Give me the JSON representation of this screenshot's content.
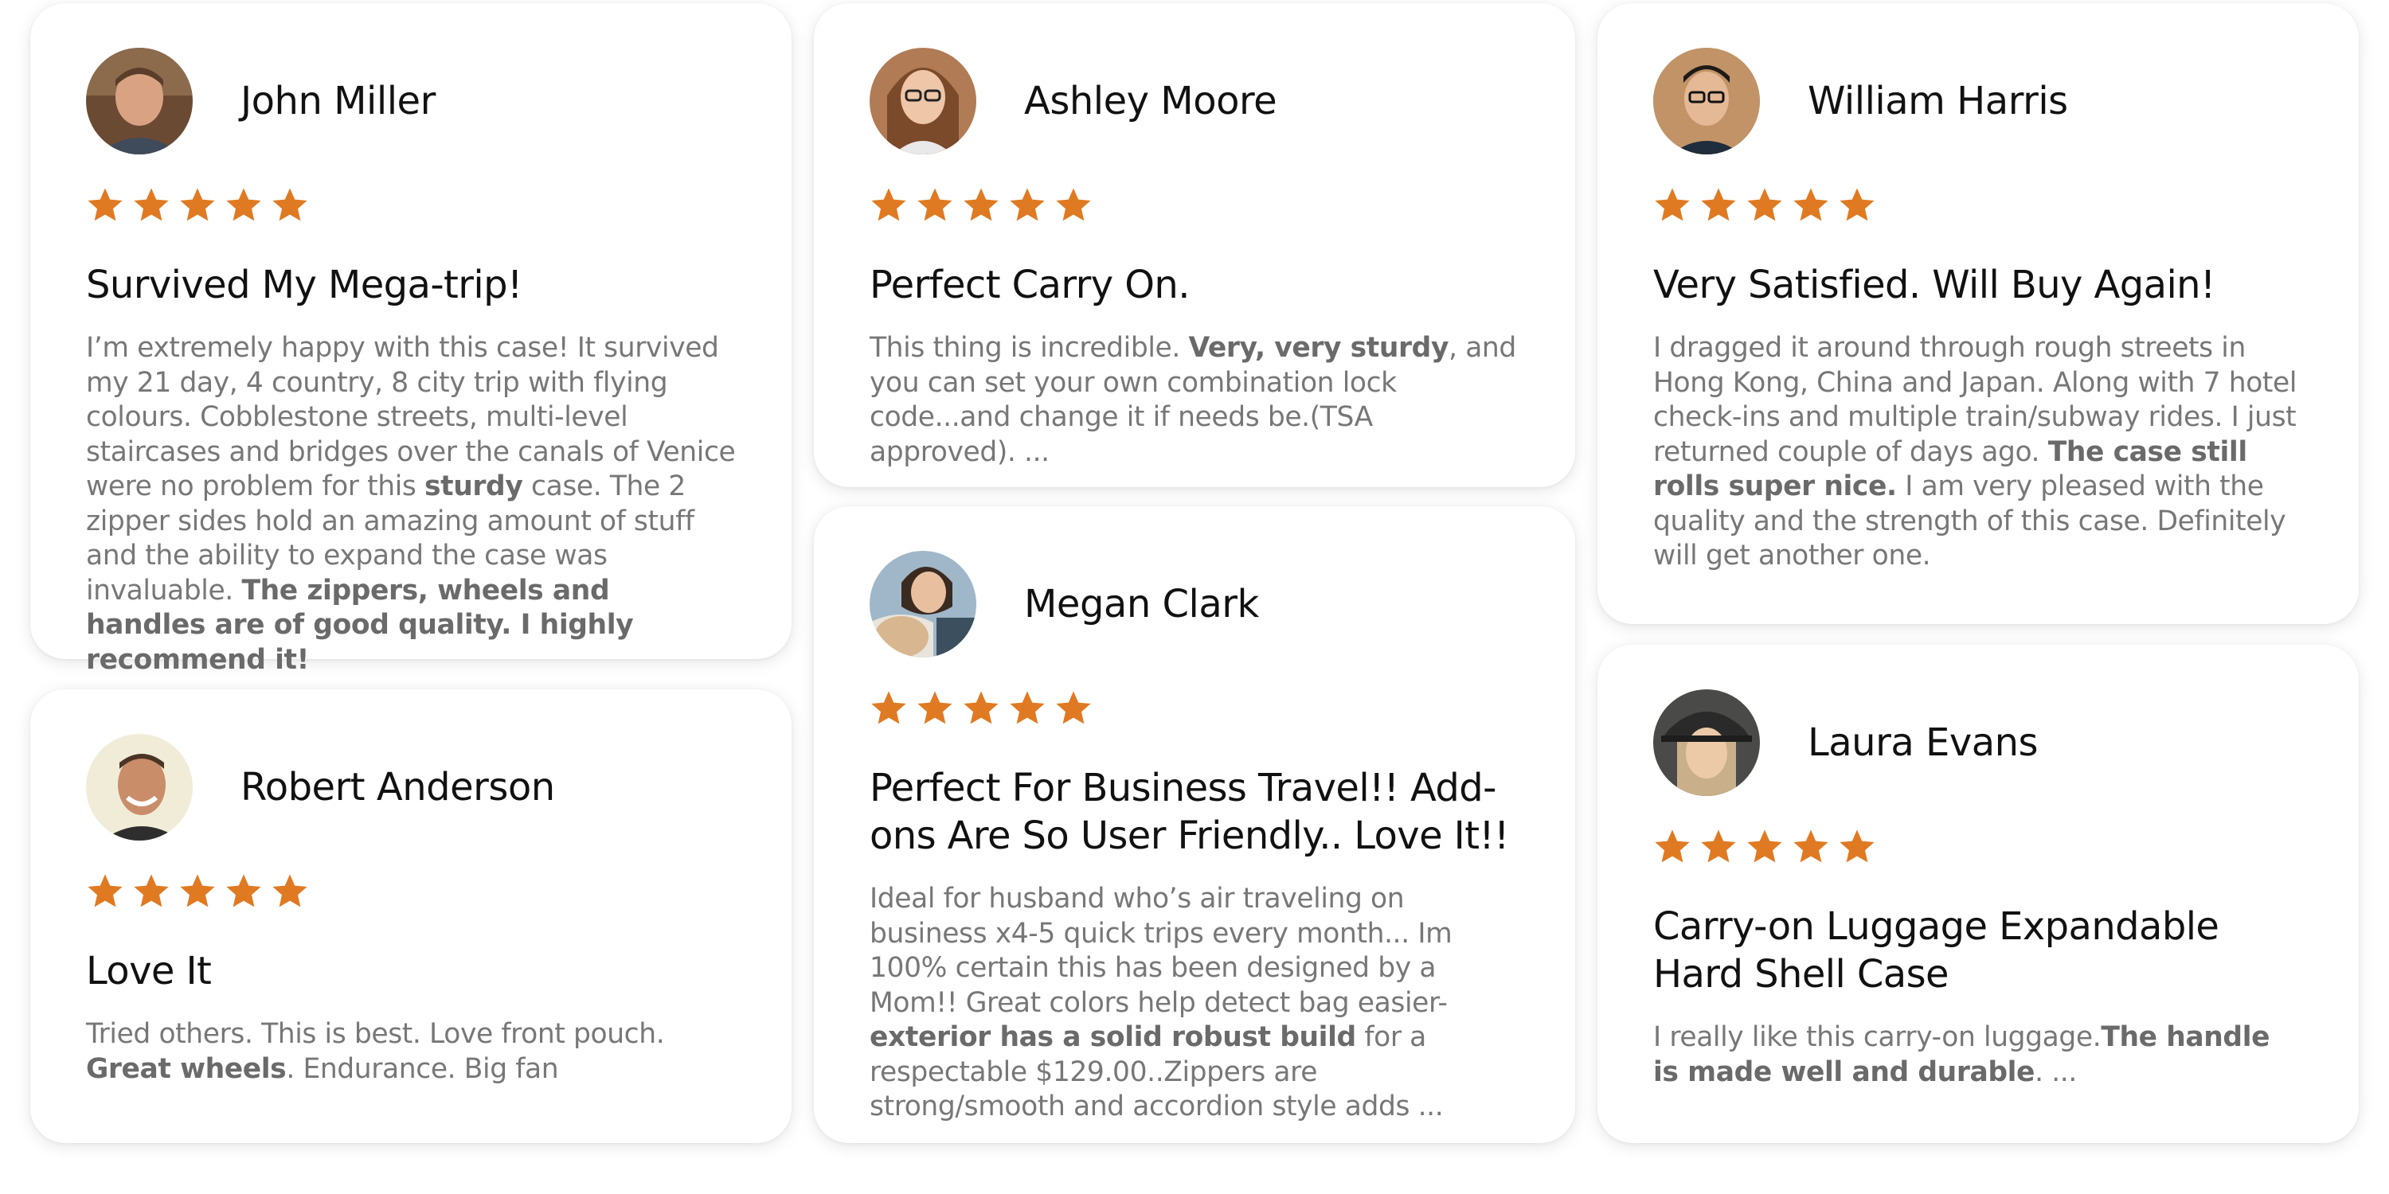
{
  "colors": {
    "star": "#e07a22",
    "text_dark": "#111111",
    "text_body": "#777777"
  },
  "reviews": [
    {
      "name": "John Miller",
      "rating": 5,
      "title": "Survived My Mega-trip!",
      "body": [
        {
          "t": "I’m extremely happy with this case!  It survived my 21 day, 4 country, 8 city trip with flying colours. Cobblestone streets, multi-level staircases and bridges over the canals of Venice were no problem for this "
        },
        {
          "t": "sturdy",
          "b": true
        },
        {
          "t": " case. The 2 zipper sides hold an amazing amount of stuff and the ability to expand the case was invaluable. "
        },
        {
          "t": "The zippers, wheels and handles are of good quality. I highly recommend it!",
          "b": true
        }
      ]
    },
    {
      "name": "Robert Anderson",
      "rating": 5,
      "title": "Love It",
      "body": [
        {
          "t": "Tried others. This is best. Love front pouch. "
        },
        {
          "t": "Great wheels",
          "b": true
        },
        {
          "t": ". Endurance. Big fan"
        }
      ]
    },
    {
      "name": "Ashley Moore",
      "rating": 5,
      "title": "Perfect Carry On.",
      "body": [
        {
          "t": "This thing is incredible. "
        },
        {
          "t": "Very, very sturdy",
          "b": true
        },
        {
          "t": ", and you can set your own combination lock code...and change it if needs be.(TSA approved). ..."
        }
      ]
    },
    {
      "name": "Megan Clark",
      "rating": 5,
      "title": "Perfect For Business Travel!! Add-ons Are So User Friendly.. Love It!!",
      "body": [
        {
          "t": "Ideal for husband who’s air traveling on business x4-5 quick trips every month...  Im 100% certain this has been designed by a Mom!! Great colors help detect bag easier- "
        },
        {
          "t": "exterior has a solid robust build",
          "b": true
        },
        {
          "t": " for a respectable $129.00..Zippers are strong/smooth and accordion style adds ..."
        }
      ]
    },
    {
      "name": "William Harris",
      "rating": 5,
      "title": "Very Satisfied. Will Buy Again!",
      "body": [
        {
          "t": " I dragged it around through rough streets in Hong Kong, China and Japan.  Along with 7 hotel check-ins and multiple train/subway rides.  I just returned couple of days ago.  "
        },
        {
          "t": "The case still rolls super nice.",
          "b": true
        },
        {
          "t": " I am very pleased with the quality and the strength of this case.  Definitely will get another one."
        }
      ]
    },
    {
      "name": "Laura Evans",
      "rating": 5,
      "title": "Carry-on Luggage Expandable Hard Shell Case",
      "body": [
        {
          "t": "I really like this carry-on luggage."
        },
        {
          "t": "The handle is made well and durable",
          "b": true
        },
        {
          "t": ". ..."
        }
      ]
    }
  ]
}
